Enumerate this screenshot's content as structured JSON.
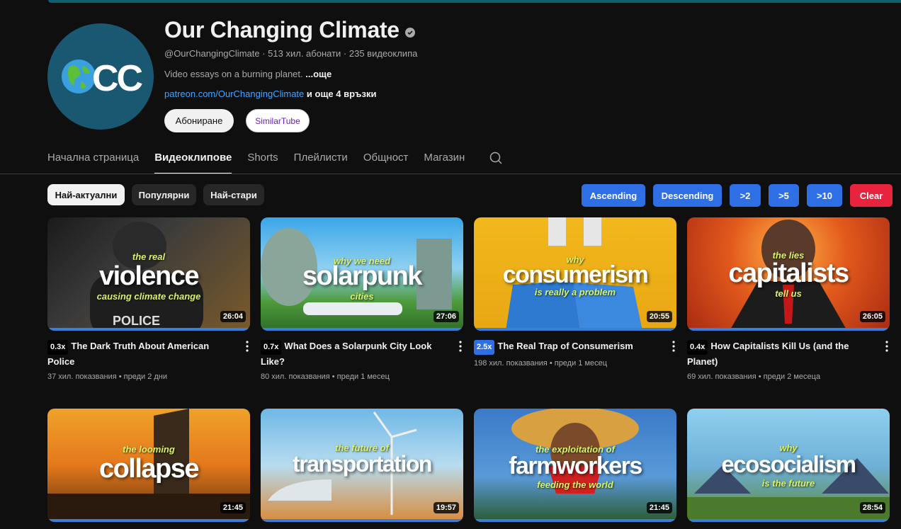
{
  "channel": {
    "name": "Our Changing Climate",
    "handle": "@OurChangingClimate",
    "subscribers": "513 хил. абонати",
    "videos_count": "235 видеоклипа",
    "description": "Video essays on a burning planet.",
    "more": "...още",
    "link": "patreon.com/OurChangingClimate",
    "more_links": "и още 4 връзки",
    "subscribe_label": "Абониране",
    "similar_label": "SimilarTube",
    "avatar_text": "CC"
  },
  "tabs": [
    {
      "label": "Начална страница"
    },
    {
      "label": "Видеоклипове"
    },
    {
      "label": "Shorts"
    },
    {
      "label": "Плейлисти"
    },
    {
      "label": "Общност"
    },
    {
      "label": "Магазин"
    }
  ],
  "chips": [
    {
      "label": "Най-актуални"
    },
    {
      "label": "Популярни"
    },
    {
      "label": "Най-стари"
    }
  ],
  "filters": [
    {
      "label": "Ascending"
    },
    {
      "label": "Descending"
    },
    {
      "label": ">2"
    },
    {
      "label": ">5"
    },
    {
      "label": ">10"
    },
    {
      "label": "Clear"
    }
  ],
  "videos": [
    {
      "speed": "0.3x",
      "title": "The Dark Truth About American Police",
      "views": "37 хил. показвания",
      "age": "преди 2 дни",
      "duration": "26:04",
      "thumb_word": "violence",
      "thumb_top": "the real",
      "thumb_bottom": "causing climate change",
      "thumb_extra": "POLICE"
    },
    {
      "speed": "0.7x",
      "title": "What Does a Solarpunk City Look Like?",
      "views": "80 хил. показвания",
      "age": "преди 1 месец",
      "duration": "27:06",
      "thumb_word": "solarpunk",
      "thumb_top": "why we need",
      "thumb_bottom": "cities"
    },
    {
      "speed": "2.5x",
      "title": "The Real Trap of Consumerism",
      "views": "198 хил. показвания",
      "age": "преди 1 месец",
      "duration": "20:55",
      "thumb_word": "consumerism",
      "thumb_top": "why",
      "thumb_bottom": "is really a problem"
    },
    {
      "speed": "0.4x",
      "title": "How Capitalists Kill Us (and the Planet)",
      "views": "69 хил. показвания",
      "age": "преди 2 месеца",
      "duration": "26:05",
      "thumb_word": "capitalists",
      "thumb_top": "the lies",
      "thumb_bottom": "tell us"
    },
    {
      "duration": "21:45",
      "thumb_word": "collapse",
      "thumb_top": "the looming",
      "thumb_bottom": ""
    },
    {
      "duration": "19:57",
      "thumb_word": "transportation",
      "thumb_top": "the future of",
      "thumb_bottom": ""
    },
    {
      "duration": "21:45",
      "thumb_word": "farmworkers",
      "thumb_top": "the exploitation of",
      "thumb_bottom": "feeding the world"
    },
    {
      "duration": "28:54",
      "thumb_word": "ecosocialism",
      "thumb_top": "why",
      "thumb_bottom": "is the future"
    }
  ],
  "colors": {
    "background": "#0f0f0f",
    "link": "#3ea6ff",
    "filter_blue": "#2f6fe6",
    "clear_red": "#e8233e",
    "progress": "#3a7fd6"
  }
}
